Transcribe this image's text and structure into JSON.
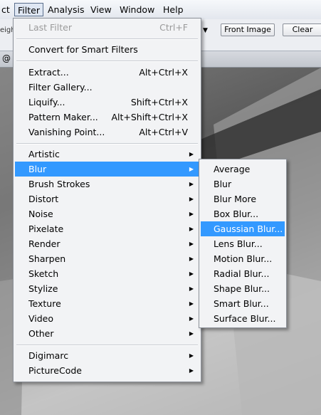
{
  "menubar": {
    "items": [
      "ct",
      "Filter",
      "Analysis",
      "View",
      "Window",
      "Help"
    ]
  },
  "options": {
    "left_text": "eigh",
    "front_image_label": "Front Image",
    "clear_label": "Clear"
  },
  "document": {
    "tab_text": "@"
  },
  "filter_menu": {
    "last_filter": {
      "label": "Last Filter",
      "shortcut": "Ctrl+F"
    },
    "convert": "Convert for Smart Filters",
    "group1": [
      {
        "label": "Extract...",
        "shortcut": "Alt+Ctrl+X"
      },
      {
        "label": "Filter Gallery...",
        "shortcut": ""
      },
      {
        "label": "Liquify...",
        "shortcut": "Shift+Ctrl+X"
      },
      {
        "label": "Pattern Maker...",
        "shortcut": "Alt+Shift+Ctrl+X"
      },
      {
        "label": "Vanishing Point...",
        "shortcut": "Alt+Ctrl+V"
      }
    ],
    "submenus": [
      "Artistic",
      "Blur",
      "Brush Strokes",
      "Distort",
      "Noise",
      "Pixelate",
      "Render",
      "Sharpen",
      "Sketch",
      "Stylize",
      "Texture",
      "Video",
      "Other"
    ],
    "plugins": [
      "Digimarc",
      "PictureCode"
    ],
    "highlighted": "Blur"
  },
  "blur_submenu": {
    "items": [
      "Average",
      "Blur",
      "Blur More",
      "Box Blur...",
      "Gaussian Blur...",
      "Lens Blur...",
      "Motion Blur...",
      "Radial Blur...",
      "Shape Blur...",
      "Smart Blur...",
      "Surface Blur..."
    ],
    "highlighted": "Gaussian Blur..."
  },
  "colors": {
    "highlight": "#3399ff",
    "menu_bg": "#f2f3f5"
  }
}
